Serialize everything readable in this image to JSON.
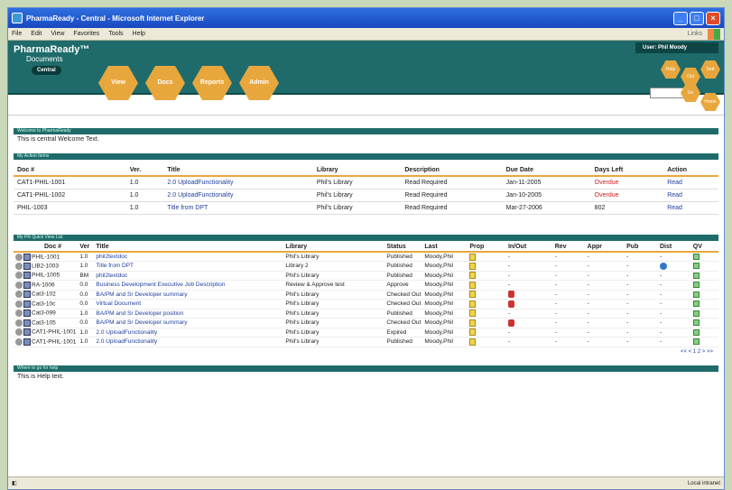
{
  "window": {
    "title": "PharmaReady - Central - Microsoft Internet Explorer"
  },
  "menu": {
    "items": [
      "File",
      "Edit",
      "View",
      "Favorites",
      "Tools",
      "Help"
    ],
    "links": "Links"
  },
  "header": {
    "logo": "PharmaReady",
    "logo_sub": "Documents",
    "logo_central": "Central",
    "user": "User: Phil Moody",
    "nav": [
      "View",
      "Docs",
      "Reports",
      "Admin"
    ],
    "mini": [
      "Help",
      "Out",
      "Sett",
      "Go",
      "Home"
    ]
  },
  "welcome": {
    "bar": "Welcome to PharmaReady",
    "text": "This is central Welcome Text."
  },
  "actions": {
    "bar": "My Action Items",
    "headers": [
      "Doc #",
      "Ver.",
      "Title",
      "Library",
      "Description",
      "Due Date",
      "Days Left",
      "Action"
    ],
    "rows": [
      {
        "doc": "CAT1-PHIL-1001",
        "ver": "1.0",
        "title": "2.0 UploadFunctionality",
        "library": "Phil's Library",
        "desc": "Read Required",
        "due": "Jan-11-2005",
        "days": "Overdue",
        "action": "Read"
      },
      {
        "doc": "CAT1-PHIL-1002",
        "ver": "1.0",
        "title": "2.0 UploadFunctionality",
        "library": "Phil's Library",
        "desc": "Read Required",
        "due": "Jan-10-2005",
        "days": "Overdue",
        "action": "Read"
      },
      {
        "doc": "PHIL-1003",
        "ver": "1.0",
        "title": "Title from DPT",
        "library": "Phil's Library",
        "desc": "Read Required",
        "due": "Mar-27-2006",
        "days": "802",
        "action": "Read"
      }
    ]
  },
  "quickview": {
    "bar": "My PR Quick View List",
    "headers": [
      "Doc #",
      "Ver",
      "Title",
      "Library",
      "Status",
      "Last",
      "Prop",
      "In/Out",
      "Rev",
      "Appr",
      "Pub",
      "Dist",
      "QV"
    ],
    "rows": [
      {
        "doc": "PHIL-1001",
        "ver": "1.0",
        "title": "phil2textdoc",
        "library": "Phil's Library",
        "status": "Published",
        "last": "Moody,Phil",
        "inout": "-",
        "rev": "-",
        "appr": "-",
        "pub": "-",
        "dist": "-"
      },
      {
        "doc": "LIB2-1003",
        "ver": "1.0",
        "title": "Title from DPT",
        "library": "Library 2",
        "status": "Published",
        "last": "Moody,Phil",
        "inout": "-",
        "rev": "-",
        "appr": "-",
        "pub": "-",
        "dist": "icon"
      },
      {
        "doc": "PHIL-1005",
        "ver": "BM",
        "title": "phil2textdoc",
        "library": "Phil's Library",
        "status": "Published",
        "last": "Moody,Phil",
        "inout": "-",
        "rev": "-",
        "appr": "-",
        "pub": "-",
        "dist": "-"
      },
      {
        "doc": "RA-1006",
        "ver": "0.0",
        "title": "Business Development Executive Job Description",
        "library": "Review & Approve test",
        "status": "Approve",
        "last": "Moody,Phil",
        "inout": "-",
        "rev": "-",
        "appr": "-",
        "pub": "-",
        "dist": "-"
      },
      {
        "doc": "Cat3-102",
        "ver": "0.0",
        "title": "BA/PM and Sr Developer summary",
        "library": "Phil's Library",
        "status": "Checked Out",
        "last": "Moody,Phil",
        "inout": "icon",
        "rev": "-",
        "appr": "-",
        "pub": "-",
        "dist": "-"
      },
      {
        "doc": "Cat3-10c",
        "ver": "0.0",
        "title": "Virtual Document",
        "library": "Phil's Library",
        "status": "Checked Out",
        "last": "Moody,Phil",
        "inout": "icon",
        "rev": "-",
        "appr": "-",
        "pub": "-",
        "dist": "-"
      },
      {
        "doc": "Cat3-099",
        "ver": "1.0",
        "title": "BA/PM and Sr Developer position",
        "library": "Phil's Library",
        "status": "Published",
        "last": "Moody,Phil",
        "inout": "-",
        "rev": "-",
        "appr": "-",
        "pub": "-",
        "dist": "-"
      },
      {
        "doc": "Cat3-105",
        "ver": "0.0",
        "title": "BA/PM and Sr Developer summary",
        "library": "Phil's Library",
        "status": "Checked Out",
        "last": "Moody,Phil",
        "inout": "icon",
        "rev": "-",
        "appr": "-",
        "pub": "-",
        "dist": "-"
      },
      {
        "doc": "CAT1-PHIL-1001",
        "ver": "1.0",
        "title": "2.0 UploadFunctionality",
        "library": "Phil's Library",
        "status": "Expired",
        "last": "Moody,Phil",
        "inout": "-",
        "rev": "-",
        "appr": "-",
        "pub": "-",
        "dist": "-"
      },
      {
        "doc": "CAT1-PHIL-1001",
        "ver": "1.0",
        "title": "2.0 UploadFunctionality",
        "library": "Phil's Library",
        "status": "Published",
        "last": "Moody,Phil",
        "inout": "-",
        "rev": "-",
        "appr": "-",
        "pub": "-",
        "dist": "-"
      }
    ],
    "pager": "<< < 1 2 > >>"
  },
  "help": {
    "bar": "Where to go for help",
    "text": "This is Help text."
  },
  "status": {
    "zone": "Local intranet"
  }
}
